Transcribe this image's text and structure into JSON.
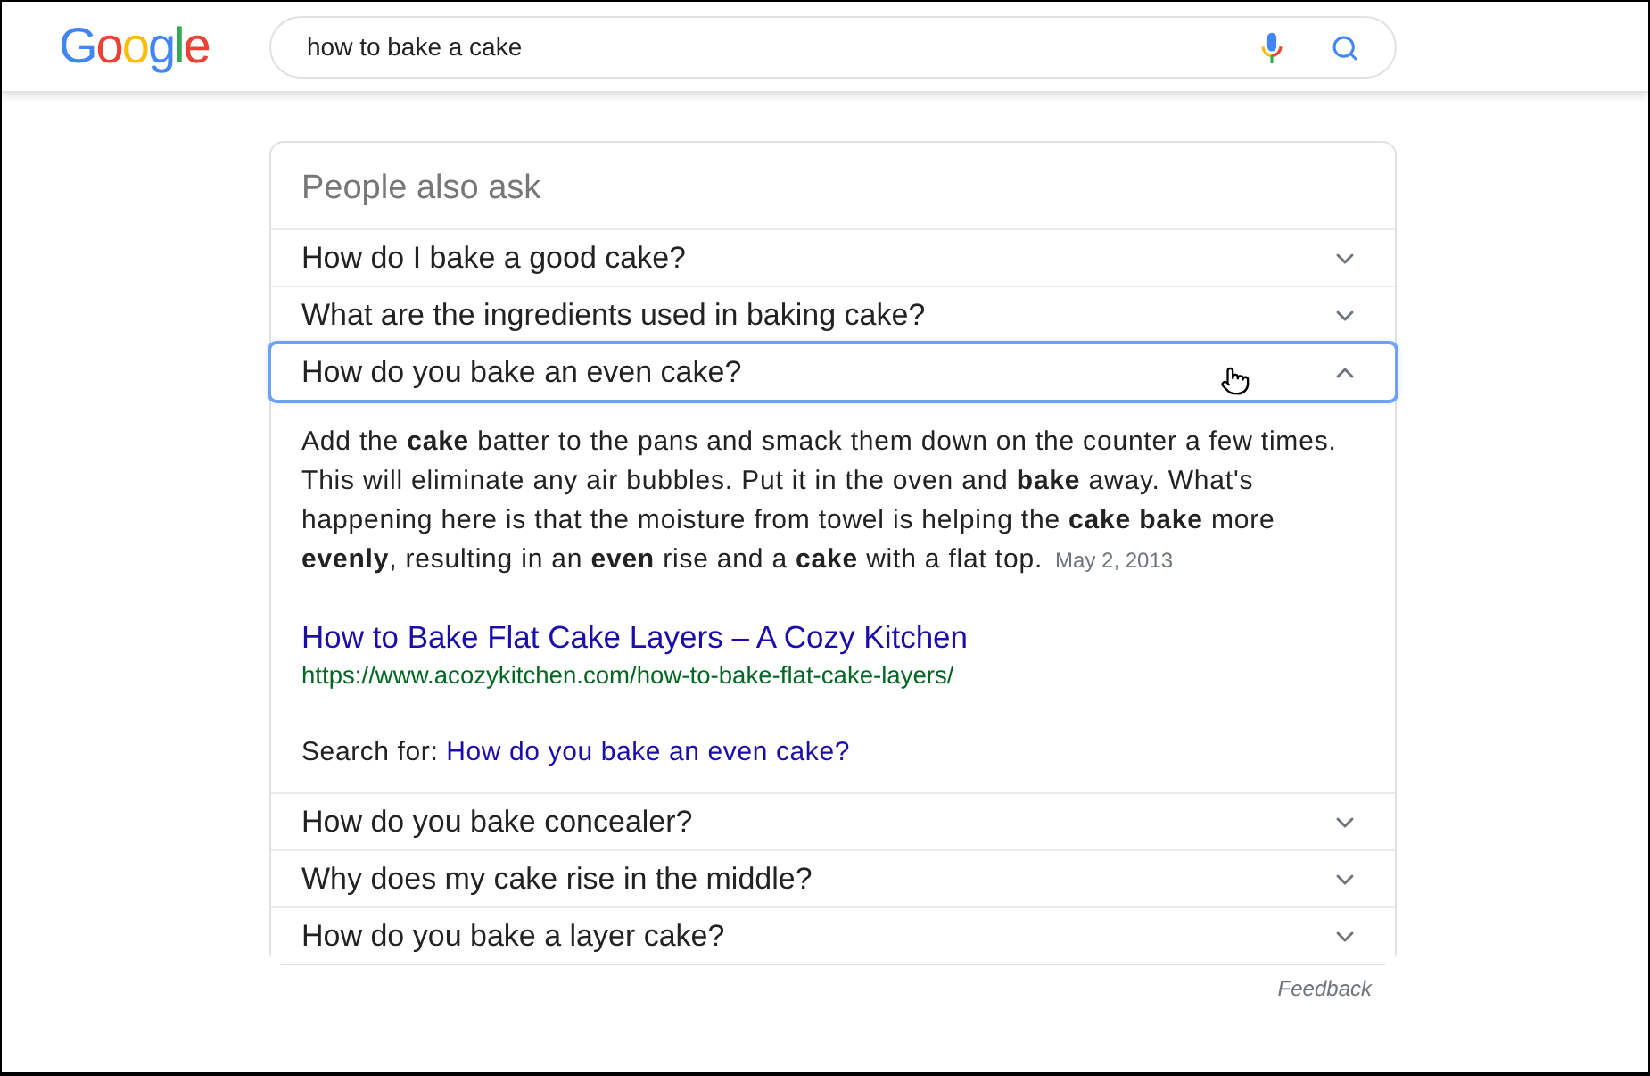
{
  "header": {
    "logo": "Google",
    "query": "how to bake a cake"
  },
  "people_also_ask": {
    "title": "People also ask",
    "questions": [
      {
        "text": "How do I bake a good cake?",
        "expanded": false,
        "focused": false,
        "hovered": false
      },
      {
        "text": "What are the ingredients used in baking cake?",
        "expanded": false,
        "focused": false,
        "hovered": false
      },
      {
        "text": "How do you bake an even cake?",
        "expanded": true,
        "focused": true,
        "hovered": true,
        "answer": {
          "snippet": "Add the **cake** batter to the pans and smack them down on the counter a few times. This will eliminate any air bubbles. Put it in the oven and **bake** away. What's happening here is that the moisture from towel is helping the **cake bake** more **evenly**, resulting in an **even** rise and a **cake** with a flat top.",
          "date": "May 2, 2013",
          "source_title": "How to Bake Flat Cake Layers – A Cozy Kitchen",
          "source_url": "https://www.acozykitchen.com/how-to-bake-flat-cake-layers/",
          "search_label": "Search for:",
          "search_link": "How do you bake an even cake?"
        }
      },
      {
        "text": "How do you bake concealer?",
        "expanded": false,
        "focused": false,
        "hovered": false
      },
      {
        "text": "Why does my cake rise in the middle?",
        "expanded": false,
        "focused": false,
        "hovered": false
      },
      {
        "text": "How do you bake a layer cake?",
        "expanded": false,
        "focused": false,
        "hovered": false
      }
    ],
    "feedback": "Feedback"
  }
}
